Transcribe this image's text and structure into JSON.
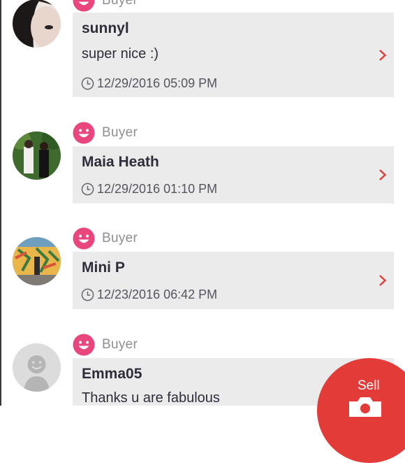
{
  "colors": {
    "accent_pink": "#e8467c",
    "chevron_red": "#e03c3c",
    "card_bg": "#ebebeb",
    "fab_red": "#e23b38"
  },
  "icons": {
    "role": "smile-icon",
    "date": "clock-icon",
    "open": "chevron-right-icon",
    "fab": "camera-icon"
  },
  "reviews": [
    {
      "role": "Buyer",
      "name": "sunnyl",
      "comment": "super nice :)",
      "date": "12/29/2016 05:09 PM",
      "avatar": "user-photo-avatar"
    },
    {
      "role": "Buyer",
      "name": "Maia Heath",
      "comment": "",
      "date": "12/29/2016 01:10 PM",
      "avatar": "user-photo-avatar"
    },
    {
      "role": "Buyer",
      "name": "Mini P",
      "comment": "",
      "date": "12/23/2016 06:42 PM",
      "avatar": "user-photo-avatar"
    },
    {
      "role": "Buyer",
      "name": "Emma05",
      "comment": "Thanks u are fabulous",
      "date": "",
      "avatar": "default-avatar"
    }
  ],
  "sell_button": {
    "label": "Sell"
  }
}
